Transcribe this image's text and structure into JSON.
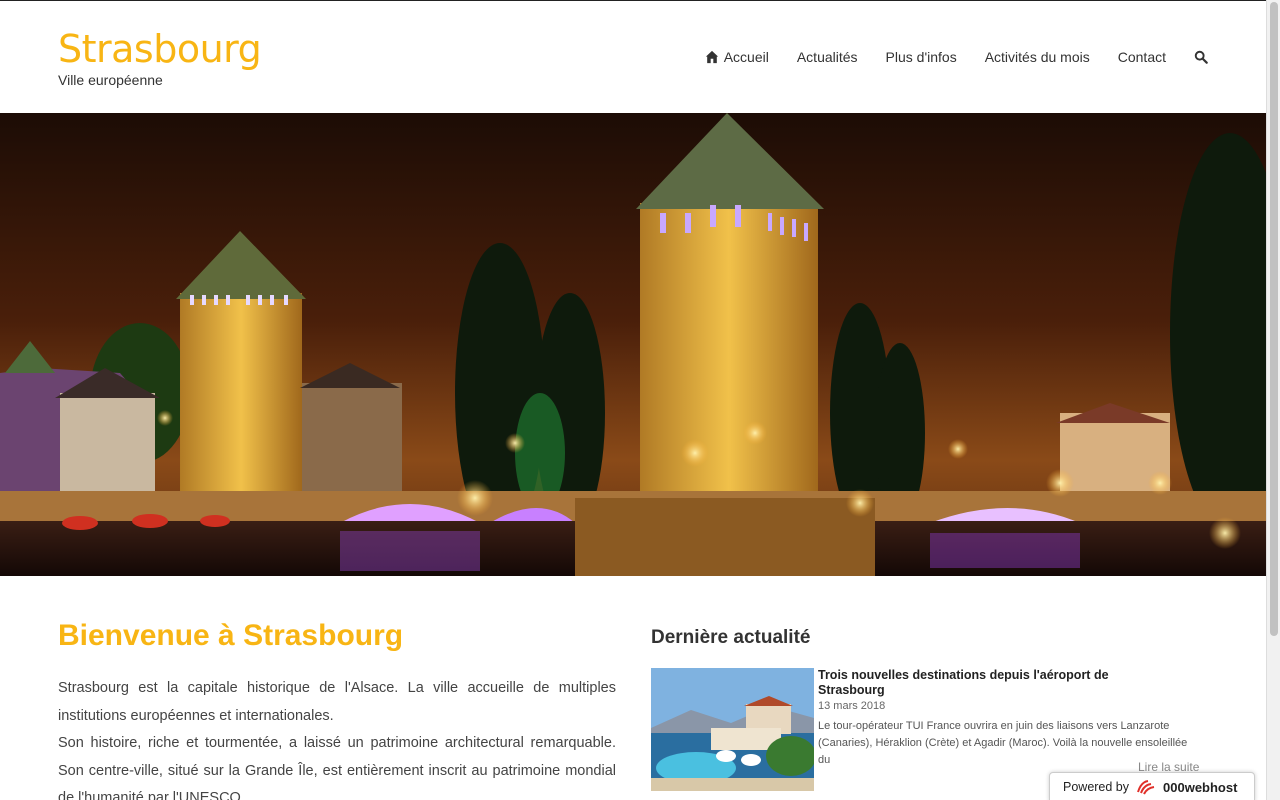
{
  "site": {
    "title": "Strasbourg",
    "tagline": "Ville européenne"
  },
  "nav": {
    "items": [
      {
        "label": "Accueil",
        "icon": "home-icon"
      },
      {
        "label": "Actualités"
      },
      {
        "label": "Plus d'infos"
      },
      {
        "label": "Activités du mois"
      },
      {
        "label": "Contact"
      }
    ],
    "search_icon": "search-icon"
  },
  "hero": {
    "image": "night view of Ponts Couverts towers, Strasbourg"
  },
  "welcome": {
    "title": "Bienvenue à Strasbourg",
    "paragraphs": [
      "Strasbourg est la capitale historique de l'Alsace. La ville accueille de multiples institutions européennes et internationales.",
      "Son histoire, riche et tourmentée, a laissé un patrimoine architectural remarquable. Son centre-ville, situé sur la Grande Île, est entièrement inscrit au patrimoine mondial de l'humanité par l'UNESCO."
    ]
  },
  "news": {
    "heading": "Dernière actualité",
    "title": "Trois nouvelles destinations depuis l'aéroport de Strasbourg",
    "date": "13 mars 2018",
    "excerpt": "Le tour-opérateur TUI France ouvrira en juin des liaisons vers Lanzarote (Canaries), Héraklion (Crète) et Agadir (Maroc). Voilà la nouvelle ensoleillée du",
    "read_more": "Lire la suite"
  },
  "footer_badge": {
    "prefix": "Powered by",
    "brand": "000webhost"
  },
  "colors": {
    "accent": "#f8b514",
    "text": "#333333"
  }
}
